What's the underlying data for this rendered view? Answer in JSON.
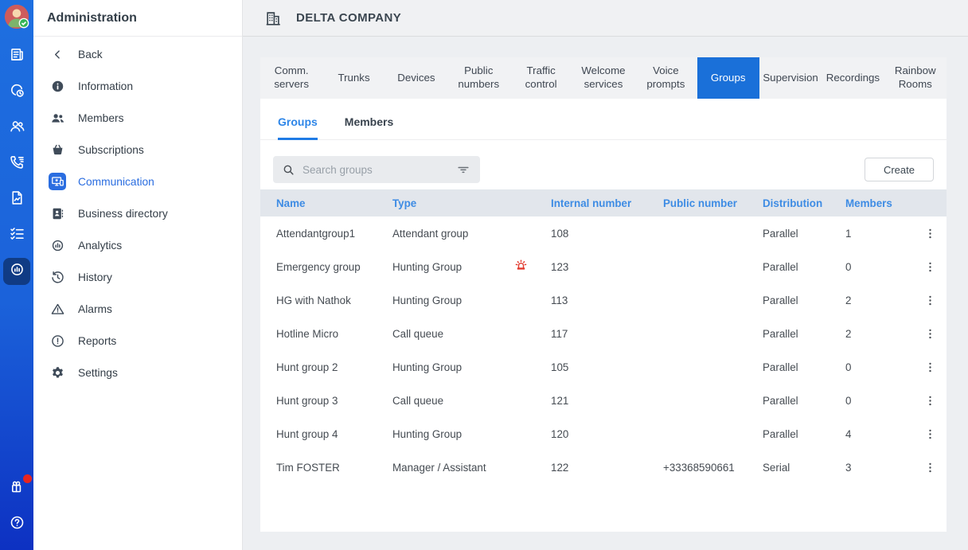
{
  "rail": {
    "avatar": {
      "name": "user-avatar",
      "status": "available"
    },
    "items": [
      {
        "icon": "bulletins"
      },
      {
        "icon": "call-history"
      },
      {
        "icon": "contacts"
      },
      {
        "icon": "calls"
      },
      {
        "icon": "documents"
      },
      {
        "icon": "tasks"
      },
      {
        "icon": "analytics",
        "active": true
      }
    ],
    "bottom_items": [
      {
        "icon": "whats-new",
        "badge": true
      },
      {
        "icon": "help"
      }
    ]
  },
  "sidebar": {
    "title": "Administration",
    "items": [
      {
        "label": "Back",
        "icon": "back"
      },
      {
        "label": "Information",
        "icon": "info"
      },
      {
        "label": "Members",
        "icon": "members"
      },
      {
        "label": "Subscriptions",
        "icon": "subscriptions"
      },
      {
        "label": "Communication",
        "icon": "communication",
        "active": true
      },
      {
        "label": "Business directory",
        "icon": "business-directory"
      },
      {
        "label": "Analytics",
        "icon": "analytics"
      },
      {
        "label": "History",
        "icon": "history"
      },
      {
        "label": "Alarms",
        "icon": "alarms"
      },
      {
        "label": "Reports",
        "icon": "reports"
      },
      {
        "label": "Settings",
        "icon": "settings"
      }
    ]
  },
  "header": {
    "company_name": "DELTA COMPANY"
  },
  "tabs": {
    "items": [
      "Comm. servers",
      "Trunks",
      "Devices",
      "Public numbers",
      "Traffic control",
      "Welcome services",
      "Voice prompts",
      "Groups",
      "Supervision",
      "Recordings",
      "Rainbow Rooms"
    ],
    "active_index": 7
  },
  "subtabs": {
    "items": [
      "Groups",
      "Members"
    ],
    "active_index": 0
  },
  "toolbar": {
    "search_placeholder": "Search groups",
    "create_label": "Create"
  },
  "table": {
    "columns": [
      "Name",
      "Type",
      "Internal number",
      "Public number",
      "Distribution",
      "Members"
    ],
    "rows": [
      {
        "name": "Attendantgroup1",
        "type": "Attendant group",
        "alarm": false,
        "internal_number": "108",
        "public_number": "",
        "distribution": "Parallel",
        "members": "1"
      },
      {
        "name": "Emergency group",
        "type": "Hunting Group",
        "alarm": true,
        "internal_number": "123",
        "public_number": "",
        "distribution": "Parallel",
        "members": "0"
      },
      {
        "name": "HG with Nathok",
        "type": "Hunting Group",
        "alarm": false,
        "internal_number": "113",
        "public_number": "",
        "distribution": "Parallel",
        "members": "2"
      },
      {
        "name": "Hotline Micro",
        "type": "Call queue",
        "alarm": false,
        "internal_number": "117",
        "public_number": "",
        "distribution": "Parallel",
        "members": "2"
      },
      {
        "name": "Hunt group 2",
        "type": "Hunting Group",
        "alarm": false,
        "internal_number": "105",
        "public_number": "",
        "distribution": "Parallel",
        "members": "0"
      },
      {
        "name": "Hunt group 3",
        "type": "Call queue",
        "alarm": false,
        "internal_number": "121",
        "public_number": "",
        "distribution": "Parallel",
        "members": "0"
      },
      {
        "name": "Hunt group 4",
        "type": "Hunting Group",
        "alarm": false,
        "internal_number": "120",
        "public_number": "",
        "distribution": "Parallel",
        "members": "4"
      },
      {
        "name": "Tim FOSTER",
        "type": "Manager / Assistant",
        "alarm": false,
        "internal_number": "122",
        "public_number": "+33368590661",
        "distribution": "Serial",
        "members": "3"
      }
    ]
  },
  "colors": {
    "accent_blue": "#1a70d9",
    "link_blue": "#2e86e8",
    "header_link_blue": "#3e8ce4",
    "alarm_red": "#e23a2e",
    "rail_gradient_top": "#1e6fe0",
    "rail_gradient_bottom": "#0d31c2"
  }
}
